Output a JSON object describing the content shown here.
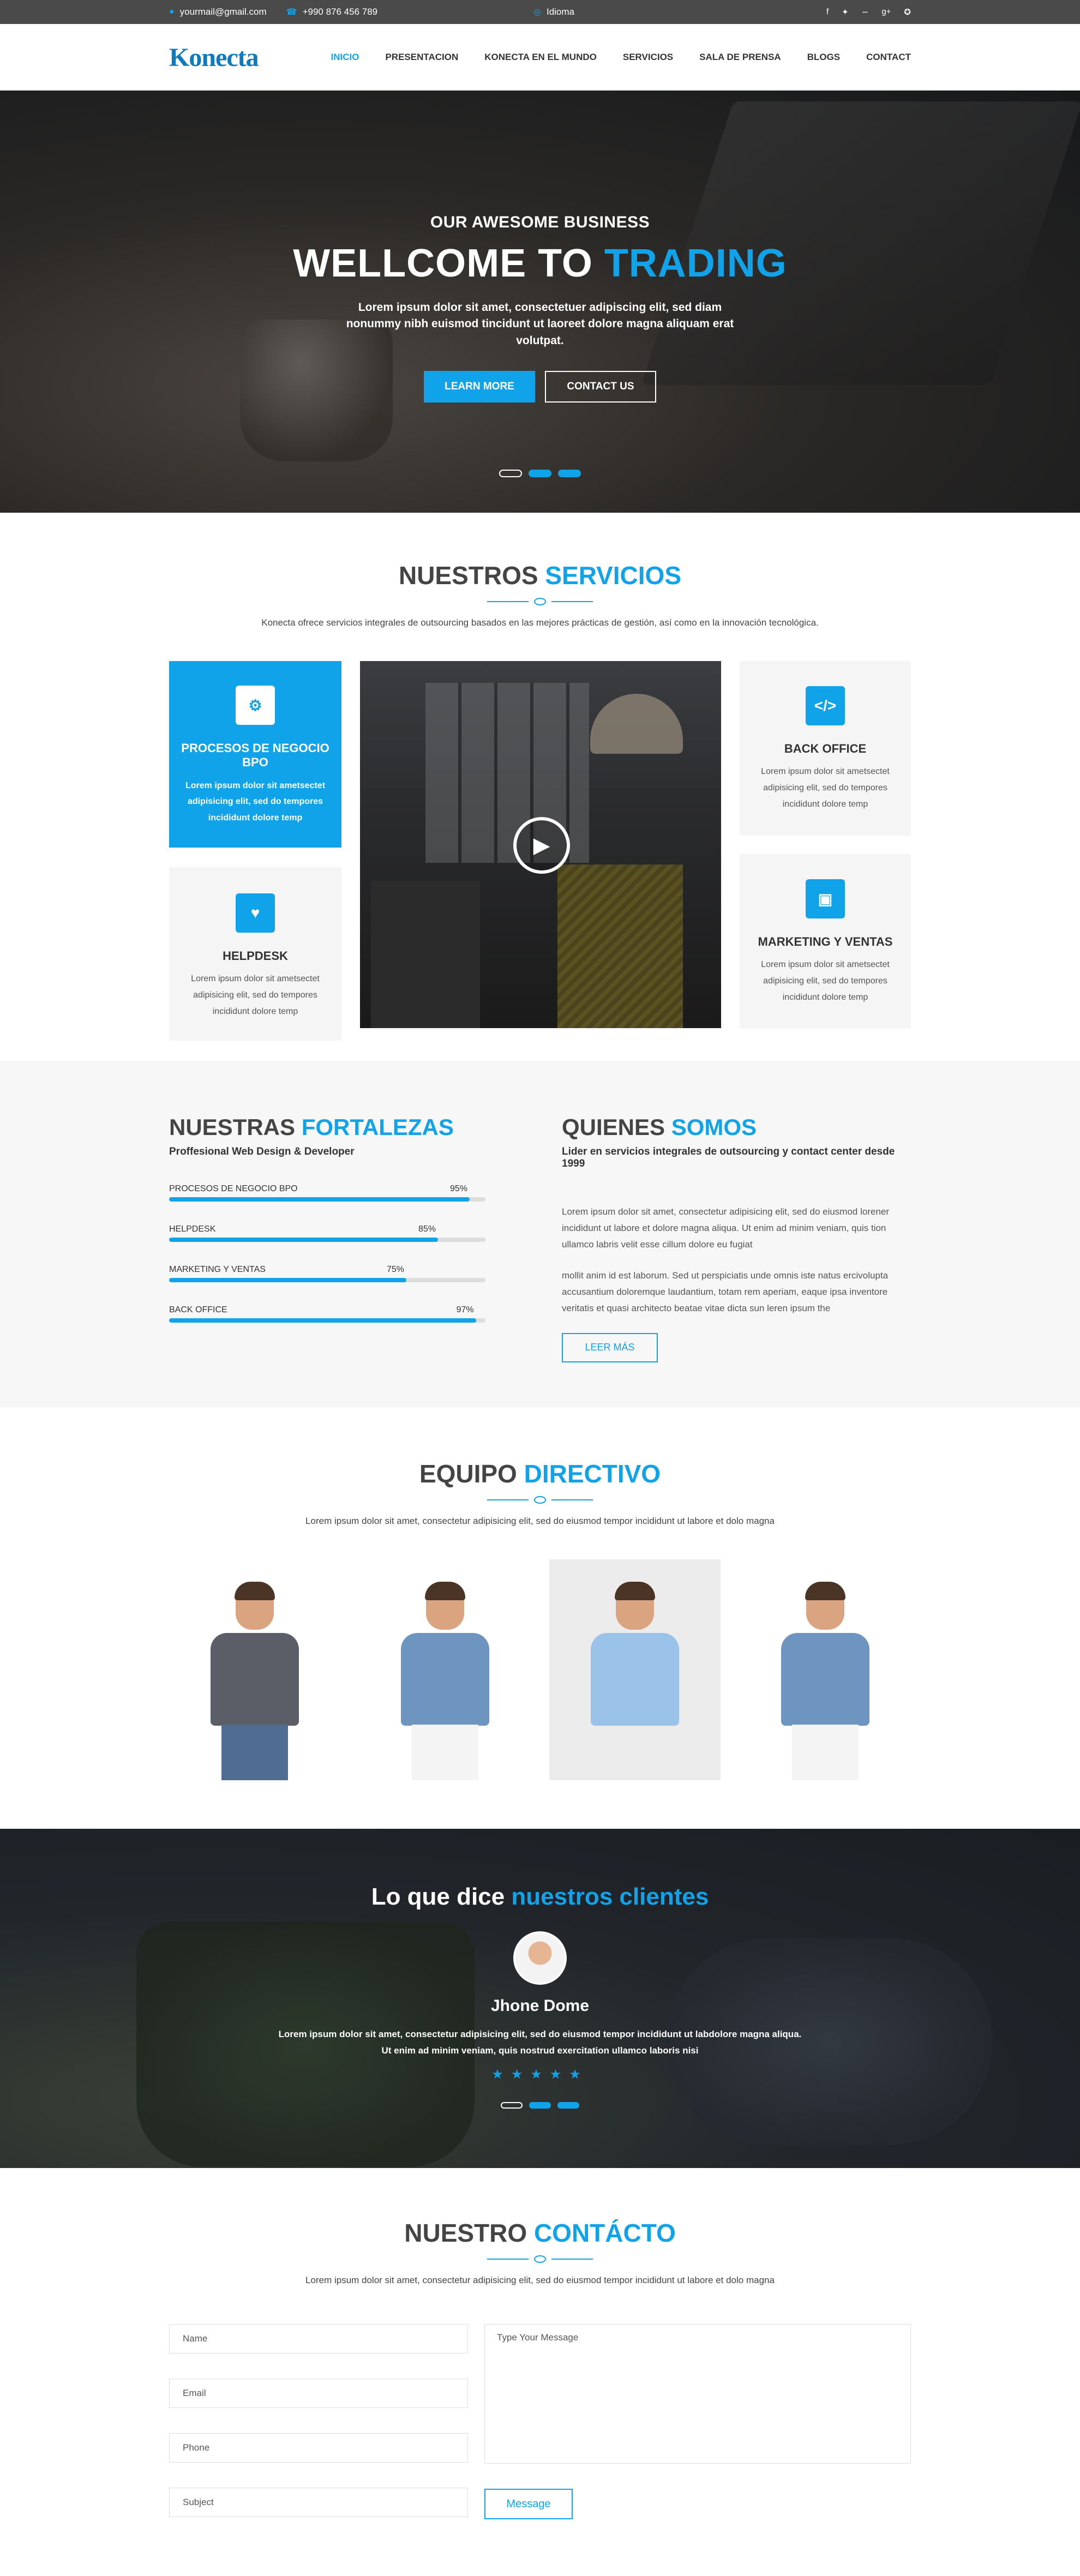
{
  "topbar": {
    "email": "yourmail@gmail.com",
    "phone": "+990 876 456 789",
    "language": "Idioma"
  },
  "header": {
    "logo": "Konecta",
    "nav": [
      "INICIO",
      "PRESENTACION",
      "KONECTA EN EL MUNDO",
      "SERVICIOS",
      "SALA DE PRENSA",
      "BLOGS",
      "CONTACT"
    ]
  },
  "hero": {
    "kicker": "OUR AWESOME BUSINESS",
    "title_1": "WELLCOME TO ",
    "title_2": "TRADING",
    "text": "Lorem ipsum dolor sit amet, consectetuer adipiscing elit, sed diam nonummy nibh euismod tincidunt ut laoreet dolore magna aliquam erat volutpat.",
    "learn_more": "LEARN MORE",
    "contact_us": "CONTACT US"
  },
  "services": {
    "title_1": "NUESTROS ",
    "title_2": "SERVICIOS",
    "subtitle": "Konecta ofrece servicios integrales de outsourcing basados en las mejores prácticas de gestión, así como en la innovación tecnológica.",
    "cards": [
      {
        "title": "PROCESOS DE NEGOCIO BPO",
        "text": "Lorem ipsum dolor sit ametsectet adipisicing elit, sed do tempores incididunt dolore temp"
      },
      {
        "title": "HELPDESK",
        "text": "Lorem ipsum dolor sit ametsectet adipisicing elit, sed do tempores incididunt dolore temp"
      },
      {
        "title": "BACK OFFICE",
        "text": "Lorem ipsum dolor sit ametsectet adipisicing elit, sed do tempores incididunt dolore temp"
      },
      {
        "title": "MARKETING Y VENTAS",
        "text": "Lorem ipsum dolor sit ametsectet adipisicing elit, sed do tempores incididunt dolore temp"
      }
    ]
  },
  "strengths": {
    "title_1": "NUESTRAS ",
    "title_2": "FORTALEZAS",
    "subtitle": "Proffesional Web Design & Developer",
    "skills": [
      {
        "label": "PROCESOS DE NEGOCIO BPO",
        "pct_text": "95%",
        "value": 95
      },
      {
        "label": "HELPDESK",
        "pct_text": "85%",
        "value": 85
      },
      {
        "label": "MARKETING Y VENTAS",
        "pct_text": "75%",
        "value": 75
      },
      {
        "label": "BACK OFFICE",
        "pct_text": "97%",
        "value": 97
      }
    ]
  },
  "about": {
    "title_1": "QUIENES ",
    "title_2": "SOMOS",
    "subtitle": "Lider en servicios integrales de outsourcing y contact center desde 1999",
    "p1": "Lorem ipsum dolor sit amet, consectetur adipisicing elit, sed do eiusmod lorener incididunt ut labore et dolore magna aliqua. Ut enim ad minim veniam, quis tion ullamco labris velit esse cillum dolore eu fugiat",
    "p2": "mollit anim id est laborum. Sed ut perspiciatis unde omnis iste natus ercivolupta accusantium doloremque laudantium, totam rem aperiam, eaque ipsa inventore veritatis et quasi architecto beatae vitae dicta sun leren ipsum the",
    "button": "LEER MÁS"
  },
  "team": {
    "title_1": "EQUIPO ",
    "title_2": "DIRECTIVO",
    "subtitle": "Lorem ipsum dolor sit amet, consectetur adipisicing elit, sed do eiusmod tempor incididunt ut labore et dolo magna"
  },
  "testimonials": {
    "title_1": "Lo que dice ",
    "title_2": "nuestros clientes",
    "name": "Jhone Dome",
    "text": "Lorem ipsum dolor sit amet, consectetur adipisicing elit, sed do eiusmod tempor incididunt ut labdolore magna aliqua. Ut enim ad minim veniam, quis nostrud exercitation ullamco laboris nisi",
    "stars": "★★★★★"
  },
  "contact": {
    "title_1": "NUESTRO ",
    "title_2": "CONTÁCTO",
    "subtitle": "Lorem ipsum dolor sit amet, consectetur adipisicing elit, sed do eiusmod tempor incididunt ut labore et dolo magna",
    "name_ph": "Name",
    "email_ph": "Email",
    "phone_ph": "Phone",
    "subject_ph": "Subject",
    "message_ph": "Type Your Message",
    "send": "Message"
  },
  "colors": {
    "accent": "#11a3ea",
    "topbar": "#4a4a4a"
  }
}
